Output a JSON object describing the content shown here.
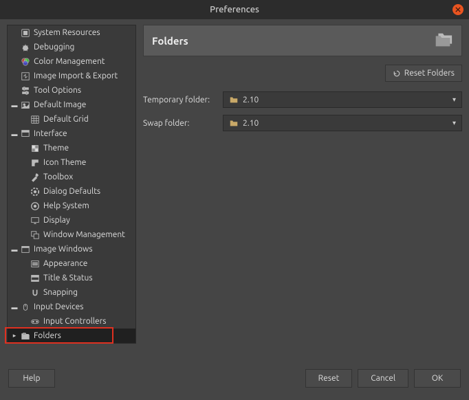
{
  "window": {
    "title": "Preferences"
  },
  "sidebar": {
    "items": [
      {
        "label": "System Resources"
      },
      {
        "label": "Debugging"
      },
      {
        "label": "Color Management"
      },
      {
        "label": "Image Import & Export"
      },
      {
        "label": "Tool Options"
      },
      {
        "label": "Default Image"
      },
      {
        "label": "Default Grid"
      },
      {
        "label": "Interface"
      },
      {
        "label": "Theme"
      },
      {
        "label": "Icon Theme"
      },
      {
        "label": "Toolbox"
      },
      {
        "label": "Dialog Defaults"
      },
      {
        "label": "Help System"
      },
      {
        "label": "Display"
      },
      {
        "label": "Window Management"
      },
      {
        "label": "Image Windows"
      },
      {
        "label": "Appearance"
      },
      {
        "label": "Title & Status"
      },
      {
        "label": "Snapping"
      },
      {
        "label": "Input Devices"
      },
      {
        "label": "Input Controllers"
      },
      {
        "label": "Folders"
      }
    ]
  },
  "panel": {
    "title": "Folders",
    "reset_label": "Reset Folders",
    "temp_label": "Temporary folder:",
    "temp_value": "2.10",
    "swap_label": "Swap folder:",
    "swap_value": "2.10"
  },
  "footer": {
    "help": "Help",
    "reset": "Reset",
    "cancel": "Cancel",
    "ok": "OK"
  }
}
